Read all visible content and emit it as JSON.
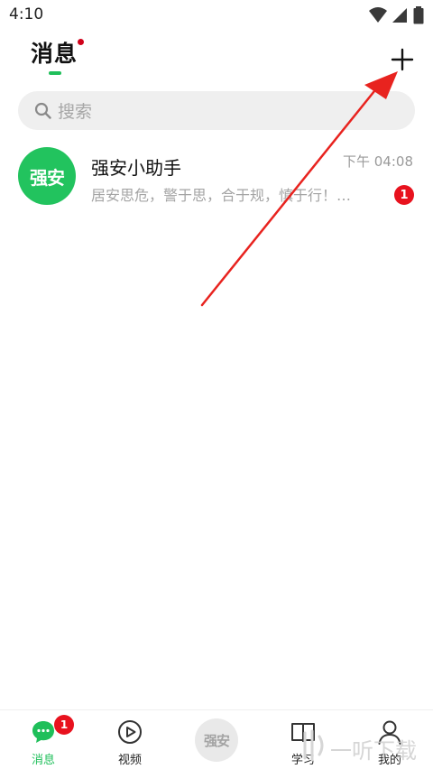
{
  "status_bar": {
    "time": "4:10",
    "icons": [
      "wifi-icon",
      "signal-icon",
      "battery-icon"
    ]
  },
  "header": {
    "title": "消息",
    "add_icon": "plus-icon"
  },
  "search": {
    "placeholder": "搜索",
    "icon": "search-icon"
  },
  "chats": [
    {
      "avatar_text": "强安",
      "name": "强安小助手",
      "time": "下午 04:08",
      "preview": "居安思危，警于思，合于规，慎于行！…",
      "unread": "1"
    }
  ],
  "bottom_nav": {
    "items": [
      {
        "label": "消息",
        "icon": "chat-bubble-icon",
        "badge": "1",
        "active": true
      },
      {
        "label": "视频",
        "icon": "play-circle-icon"
      },
      {
        "label": "强安",
        "icon": "app-logo"
      },
      {
        "label": "学习",
        "icon": "book-icon"
      },
      {
        "label": "我的",
        "icon": "person-icon"
      }
    ]
  },
  "watermark": "一听下载",
  "colors": {
    "accent": "#1fbf5a",
    "avatar_bg": "#22c35e",
    "badge": "#e8121e",
    "title_dot": "#d0021b",
    "arrow": "#e8231f",
    "search_bg": "#efefef"
  }
}
